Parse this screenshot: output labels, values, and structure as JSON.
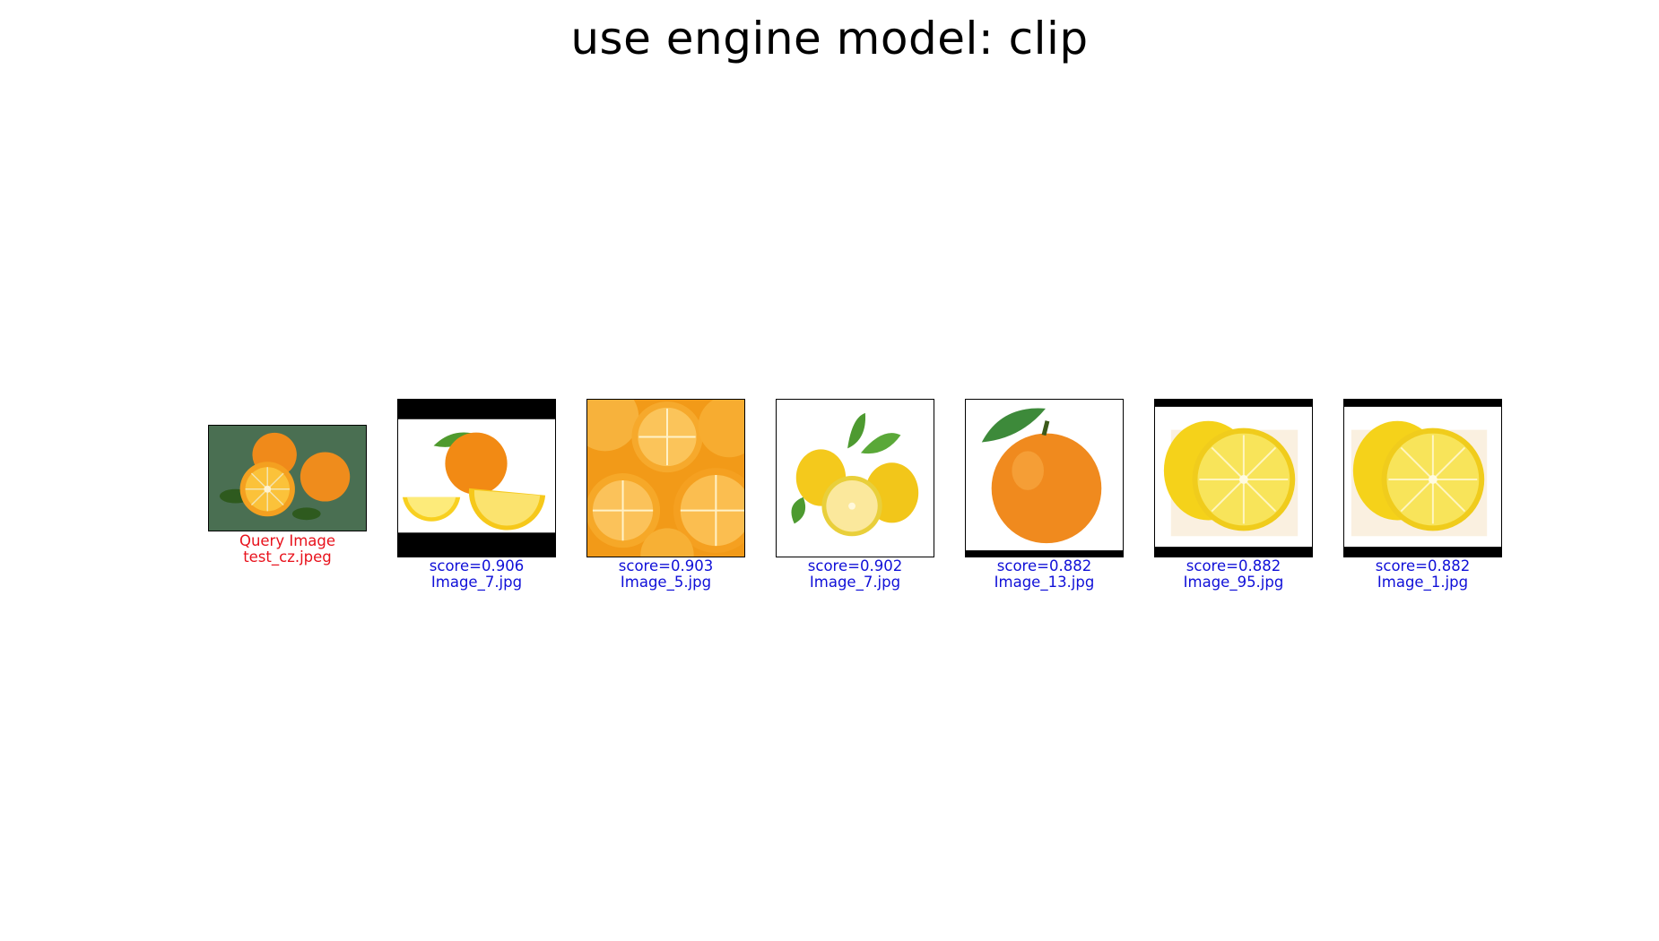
{
  "title": "use engine model: clip",
  "query": {
    "label": "Query Image",
    "filename": "test_cz.jpeg",
    "icon": "oranges-on-green-thumbnail",
    "color": "#e8121c"
  },
  "results": [
    {
      "score": "score=0.906",
      "filename": "Image_7.jpg",
      "icon": "orange-with-lemon-slices-thumbnail"
    },
    {
      "score": "score=0.903",
      "filename": "Image_5.jpg",
      "icon": "orange-slices-thumbnail"
    },
    {
      "score": "score=0.902",
      "filename": "Image_7.jpg",
      "icon": "lemons-with-leaves-thumbnail"
    },
    {
      "score": "score=0.882",
      "filename": "Image_13.jpg",
      "icon": "single-orange-thumbnail"
    },
    {
      "score": "score=0.882",
      "filename": "Image_95.jpg",
      "icon": "lemon-half-thumbnail"
    },
    {
      "score": "score=0.882",
      "filename": "Image_1.jpg",
      "icon": "lemon-half-thumbnail"
    }
  ],
  "result_color": "#1010d8"
}
